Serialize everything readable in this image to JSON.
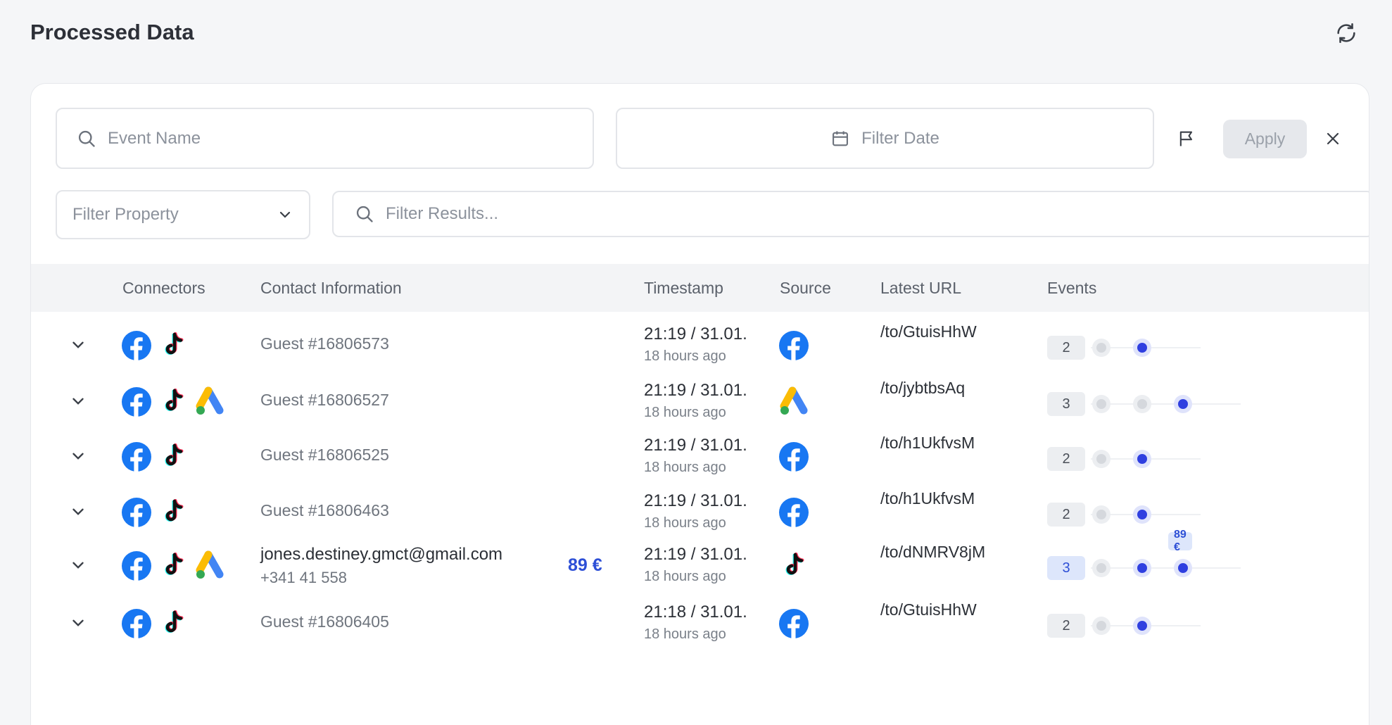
{
  "header": {
    "title": "Processed Data",
    "refresh_icon": "refresh-icon"
  },
  "filters": {
    "event_name_placeholder": "Event Name",
    "filter_date_placeholder": "Filter Date",
    "apply_label": "Apply",
    "filter_property_placeholder": "Filter Property",
    "filter_results_placeholder": "Filter Results..."
  },
  "table": {
    "columns": [
      "Connectors",
      "Contact Information",
      "Timestamp",
      "Source",
      "Latest URL",
      "Events"
    ],
    "rows": [
      {
        "connectors": [
          "facebook",
          "tiktok"
        ],
        "contact": "Guest #16806573",
        "email": "",
        "phone": "",
        "revenue": "",
        "time": "21:19 / 31.01.",
        "ago": "18 hours ago",
        "source": "facebook",
        "url": "/to/GtuisHhW",
        "events": "2",
        "event_dots": [
          "grey",
          "blue"
        ],
        "event_badge": ""
      },
      {
        "connectors": [
          "facebook",
          "tiktok",
          "google-ads"
        ],
        "contact": "Guest #16806527",
        "email": "",
        "phone": "",
        "revenue": "",
        "time": "21:19 / 31.01.",
        "ago": "18 hours ago",
        "source": "google-ads",
        "url": "/to/jybtbsAq",
        "events": "3",
        "event_dots": [
          "grey",
          "grey",
          "blue"
        ],
        "event_badge": ""
      },
      {
        "connectors": [
          "facebook",
          "tiktok"
        ],
        "contact": "Guest #16806525",
        "email": "",
        "phone": "",
        "revenue": "",
        "time": "21:19 / 31.01.",
        "ago": "18 hours ago",
        "source": "facebook",
        "url": "/to/h1UkfvsM",
        "events": "2",
        "event_dots": [
          "grey",
          "blue"
        ],
        "event_badge": ""
      },
      {
        "connectors": [
          "facebook",
          "tiktok"
        ],
        "contact": "Guest #16806463",
        "email": "",
        "phone": "",
        "revenue": "",
        "time": "21:19 / 31.01.",
        "ago": "18 hours ago",
        "source": "facebook",
        "url": "/to/h1UkfvsM",
        "events": "2",
        "event_dots": [
          "grey",
          "blue"
        ],
        "event_badge": ""
      },
      {
        "connectors": [
          "facebook",
          "tiktok",
          "google-ads"
        ],
        "contact": "",
        "email": "jones.destiney.gmct@gmail.com",
        "phone": "+341 41 558",
        "revenue": "89 €",
        "time": "21:19 / 31.01.",
        "ago": "18 hours ago",
        "source": "tiktok",
        "url": "/to/dNMRV8jM",
        "events": "3",
        "event_dots": [
          "grey",
          "blue",
          "blue"
        ],
        "event_badge": "89 €"
      },
      {
        "connectors": [
          "facebook",
          "tiktok"
        ],
        "contact": "Guest #16806405",
        "email": "",
        "phone": "",
        "revenue": "",
        "time": "21:18 / 31.01.",
        "ago": "18 hours ago",
        "source": "facebook",
        "url": "/to/GtuisHhW",
        "events": "2",
        "event_dots": [
          "grey",
          "blue"
        ],
        "event_badge": ""
      }
    ]
  },
  "colors": {
    "accent": "#2d4fd6",
    "facebook": "#1877f2",
    "dot_blue": "#2f3fe0"
  }
}
